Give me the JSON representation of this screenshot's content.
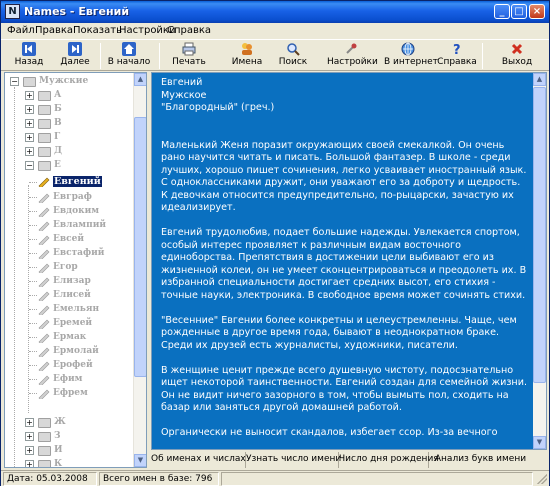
{
  "window": {
    "title": "Names - Евгений"
  },
  "menu": [
    "Файл",
    "Правка",
    "Показать",
    "Настройки",
    "Справка"
  ],
  "toolbar": {
    "back": "Назад",
    "next": "Далее",
    "start": "В начало",
    "print": "Печать",
    "names": "Имена",
    "search": "Поиск",
    "settings": "Настройки",
    "internet": "В интернет",
    "help": "Справка",
    "exit": "Выход"
  },
  "tree": {
    "root": "Мужские",
    "letters_top": [
      "А",
      "Б",
      "В",
      "Г",
      "Д",
      "Е"
    ],
    "selected": "Евгений",
    "children": [
      "Евграф",
      "Евдоким",
      "Евлампий",
      "Евсей",
      "Евстафий",
      "Егор",
      "Елизар",
      "Елисей",
      "Емельян",
      "Еремей",
      "Ермак",
      "Ермолай",
      "Ерофей",
      "Ефим",
      "Ефрем"
    ],
    "letters_bottom": [
      "Ж",
      "З",
      "И",
      "К"
    ]
  },
  "content": {
    "header": [
      "Евгений",
      "Мужское",
      "\"Благородный\" (греч.)"
    ],
    "paragraphs": [
      "Маленький Женя поразит окружающих своей смекалкой. Он очень рано научится читать и писать. Большой фантазер. В школе - среди лучших, хорошо пишет сочинения, легко усваивает иностранный язык. С одноклассниками дружит, они уважают его за доброту и щедрость. К девочкам относится предупредительно, по-рыцарски, зачастую их идеализирует.",
      "Евгений трудолюбив, подает большие надежды. Увлекается спортом, особый интерес проявляет к различным видам восточного единоборства. Препятствия в достижении цели выбивают его из жизненной колеи, он не умеет сконцентрироваться и преодолеть их. В избранной специальности достигает средних высот, его стихия - точные науки, электроника. В свободное время может сочинять стихи.",
      "\"Весенние\" Евгении более конкретны и целеустремленны. Чаще, чем рожденные в другое время года, бывают в неоднократном браке. Среди их друзей есть журналисты, художники, писатели.",
      "В женщине ценит прежде всего душевную чистоту, подосзнательно ищет некоторой таинственности. Евгений создан для семейной жизни. Он не видит ничего зазорного в том, чтобы вымыть пол, сходить на базар или заняться другой домашней работой.",
      "Органически не выносит скандалов, избегает ссор. Из-за вечного"
    ]
  },
  "tabs": [
    "Об именах и числах",
    "Узнать число имени",
    "Число дня рождения",
    "Анализ букв имени"
  ],
  "status": {
    "date": "Дата: 05.03.2008",
    "count": "Всего имен в базе: 796"
  },
  "colors": {
    "content_bg": "#0a70c0",
    "titlebar": "#0b4fcf",
    "selection": "#0a246a"
  }
}
